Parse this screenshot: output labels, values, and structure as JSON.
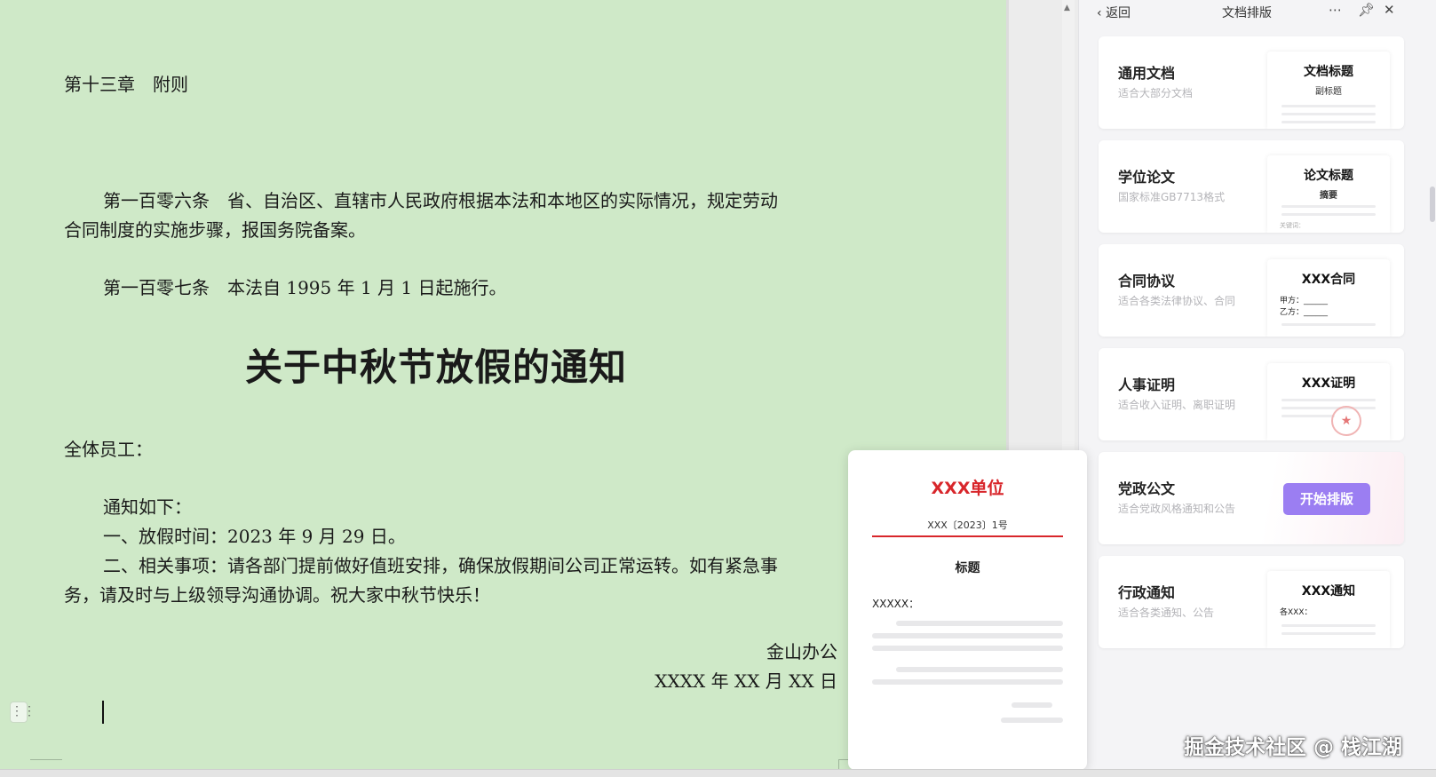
{
  "document": {
    "chapter_heading": "第十三章　附则",
    "article_106_line1": "第一百零六条　省、自治区、直辖市人民政府根据本法和本地区的实际情况，规定劳动",
    "article_106_line2": "合同制度的实施步骤，报国务院备案。",
    "article_107": "第一百零七条　本法自 1995 年 1 月 1 日起施行。",
    "notice_title": "关于中秋节放假的通知",
    "salutation": "全体员工：",
    "notice_intro": "通知如下：",
    "item_1": "一、放假时间：2023 年 9 月 29 日。",
    "item_2_line1": "二、相关事项：请各部门提前做好值班安排，确保放假期间公司正常运转。如有紧急事",
    "item_2_line2": "务，请及时与上级领导沟通协调。祝大家中秋节快乐！",
    "signature": "金山办公",
    "date": "XXXX 年 XX 月 XX 日"
  },
  "panel": {
    "back_label": "返回",
    "title": "文档排版",
    "more_icon": "more-icon",
    "pin_icon": "pin-icon",
    "close_icon": "close-icon",
    "cards": [
      {
        "title": "通用文档",
        "desc": "适合大部分文档",
        "thumb_title": "文档标题",
        "thumb_sub": "副标题"
      },
      {
        "title": "学位论文",
        "desc": "国家标准GB7713格式",
        "thumb_title": "论文标题",
        "thumb_sub": "摘要",
        "thumb_tiny": "关键词："
      },
      {
        "title": "合同协议",
        "desc": "适合各类法律协议、合同",
        "thumb_title": "XXX合同",
        "party_a": "甲方：",
        "party_b": "乙方："
      },
      {
        "title": "人事证明",
        "desc": "适合收入证明、离职证明",
        "thumb_title": "XXX证明",
        "seal_icon": "seal-icon"
      },
      {
        "title": "党政公文",
        "desc": "适合党政风格通知和公告",
        "button": "开始排版"
      },
      {
        "title": "行政通知",
        "desc": "适合各类通知、公告",
        "thumb_title": "XXX通知",
        "thumb_to": "各XXX："
      }
    ]
  },
  "preview": {
    "unit": "XXX单位",
    "doc_number": "XXX〔2023〕1号",
    "title": "标题",
    "addressee": "XXXXX："
  },
  "watermark": "掘金技术社区 @ 栈江湖",
  "colors": {
    "doc_background": "#cfe9c8",
    "accent_purple": "#9b7ef2",
    "preview_red": "#d8262b"
  }
}
